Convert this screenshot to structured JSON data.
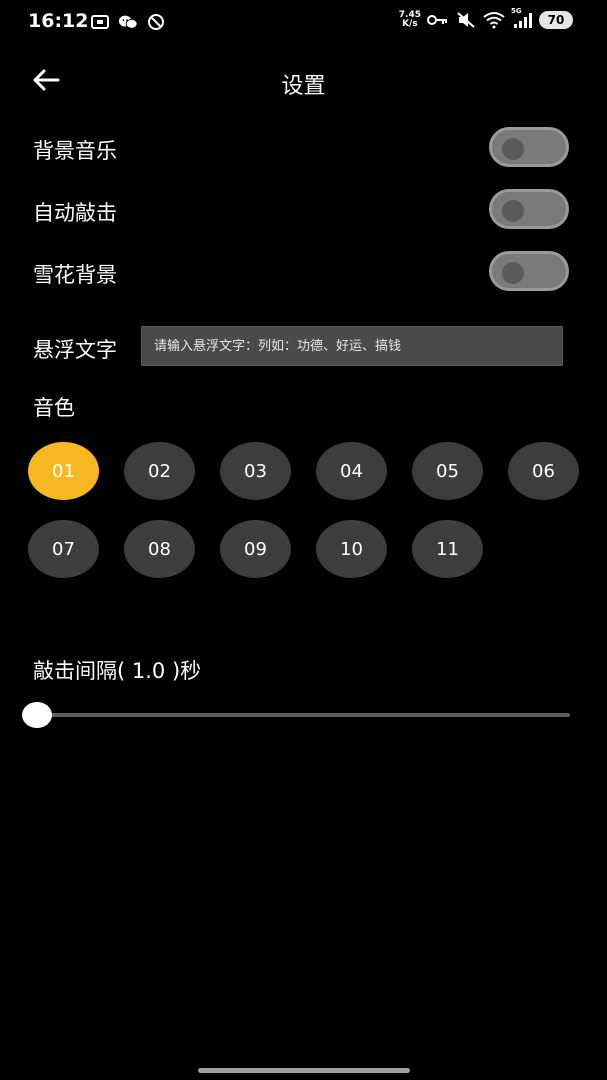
{
  "status_bar": {
    "time": "16:12",
    "net_speed_value": "7.45",
    "net_speed_unit": "K/s",
    "signal_label": "5G",
    "battery": "70",
    "left_icons": [
      "screen-record-icon",
      "wechat-icon",
      "no-disturb-icon"
    ],
    "right_icons": [
      "key-icon",
      "mute-icon",
      "wifi-icon",
      "signal-icon"
    ]
  },
  "header": {
    "title": "设置",
    "back_icon": "arrow-left-icon"
  },
  "settings": {
    "bg_music": {
      "label": "背景音乐",
      "enabled": false
    },
    "auto_tap": {
      "label": "自动敲击",
      "enabled": false
    },
    "snow_bg": {
      "label": "雪花背景",
      "enabled": false
    }
  },
  "float_text": {
    "label": "悬浮文字",
    "value": "",
    "placeholder": "请输入悬浮文字：列如：功德、好运、搞钱"
  },
  "tone": {
    "label": "音色",
    "options": [
      "01",
      "02",
      "03",
      "04",
      "05",
      "06",
      "07",
      "08",
      "09",
      "10",
      "11"
    ],
    "selected": "01",
    "colors": {
      "active": "#f5b820",
      "inactive": "#3d3d3d"
    }
  },
  "interval": {
    "prefix": "敲击间隔(",
    "value": "1.0",
    "suffix": ")秒",
    "slider_fraction": 0.0
  }
}
